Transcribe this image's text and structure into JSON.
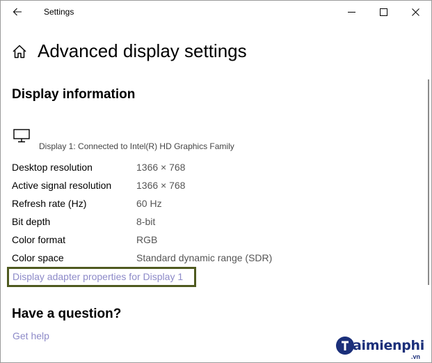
{
  "titlebar": {
    "title": "Settings",
    "back_icon": "back-arrow-icon",
    "minimize_icon": "minimize-icon",
    "maximize_icon": "maximize-icon",
    "close_icon": "close-icon"
  },
  "header": {
    "home_icon": "home-icon",
    "title": "Advanced display settings"
  },
  "display_info": {
    "section_title": "Display information",
    "monitor_icon": "monitor-icon",
    "display_description": "Display 1: Connected to Intel(R) HD Graphics Family",
    "rows": [
      {
        "label": "Desktop resolution",
        "value": "1366 × 768"
      },
      {
        "label": "Active signal resolution",
        "value": "1366 × 768"
      },
      {
        "label": "Refresh rate (Hz)",
        "value": "60 Hz"
      },
      {
        "label": "Bit depth",
        "value": "8-bit"
      },
      {
        "label": "Color format",
        "value": "RGB"
      },
      {
        "label": "Color space",
        "value": "Standard dynamic range (SDR)"
      }
    ],
    "adapter_link": "Display adapter properties for Display 1",
    "highlight_color": "#4f5a1f",
    "link_color": "#8d8ac8"
  },
  "help": {
    "title": "Have a question?",
    "link": "Get help"
  },
  "watermark": {
    "brand": "aimienphi",
    "suffix": ".vn",
    "color": "#1b2f7a"
  }
}
